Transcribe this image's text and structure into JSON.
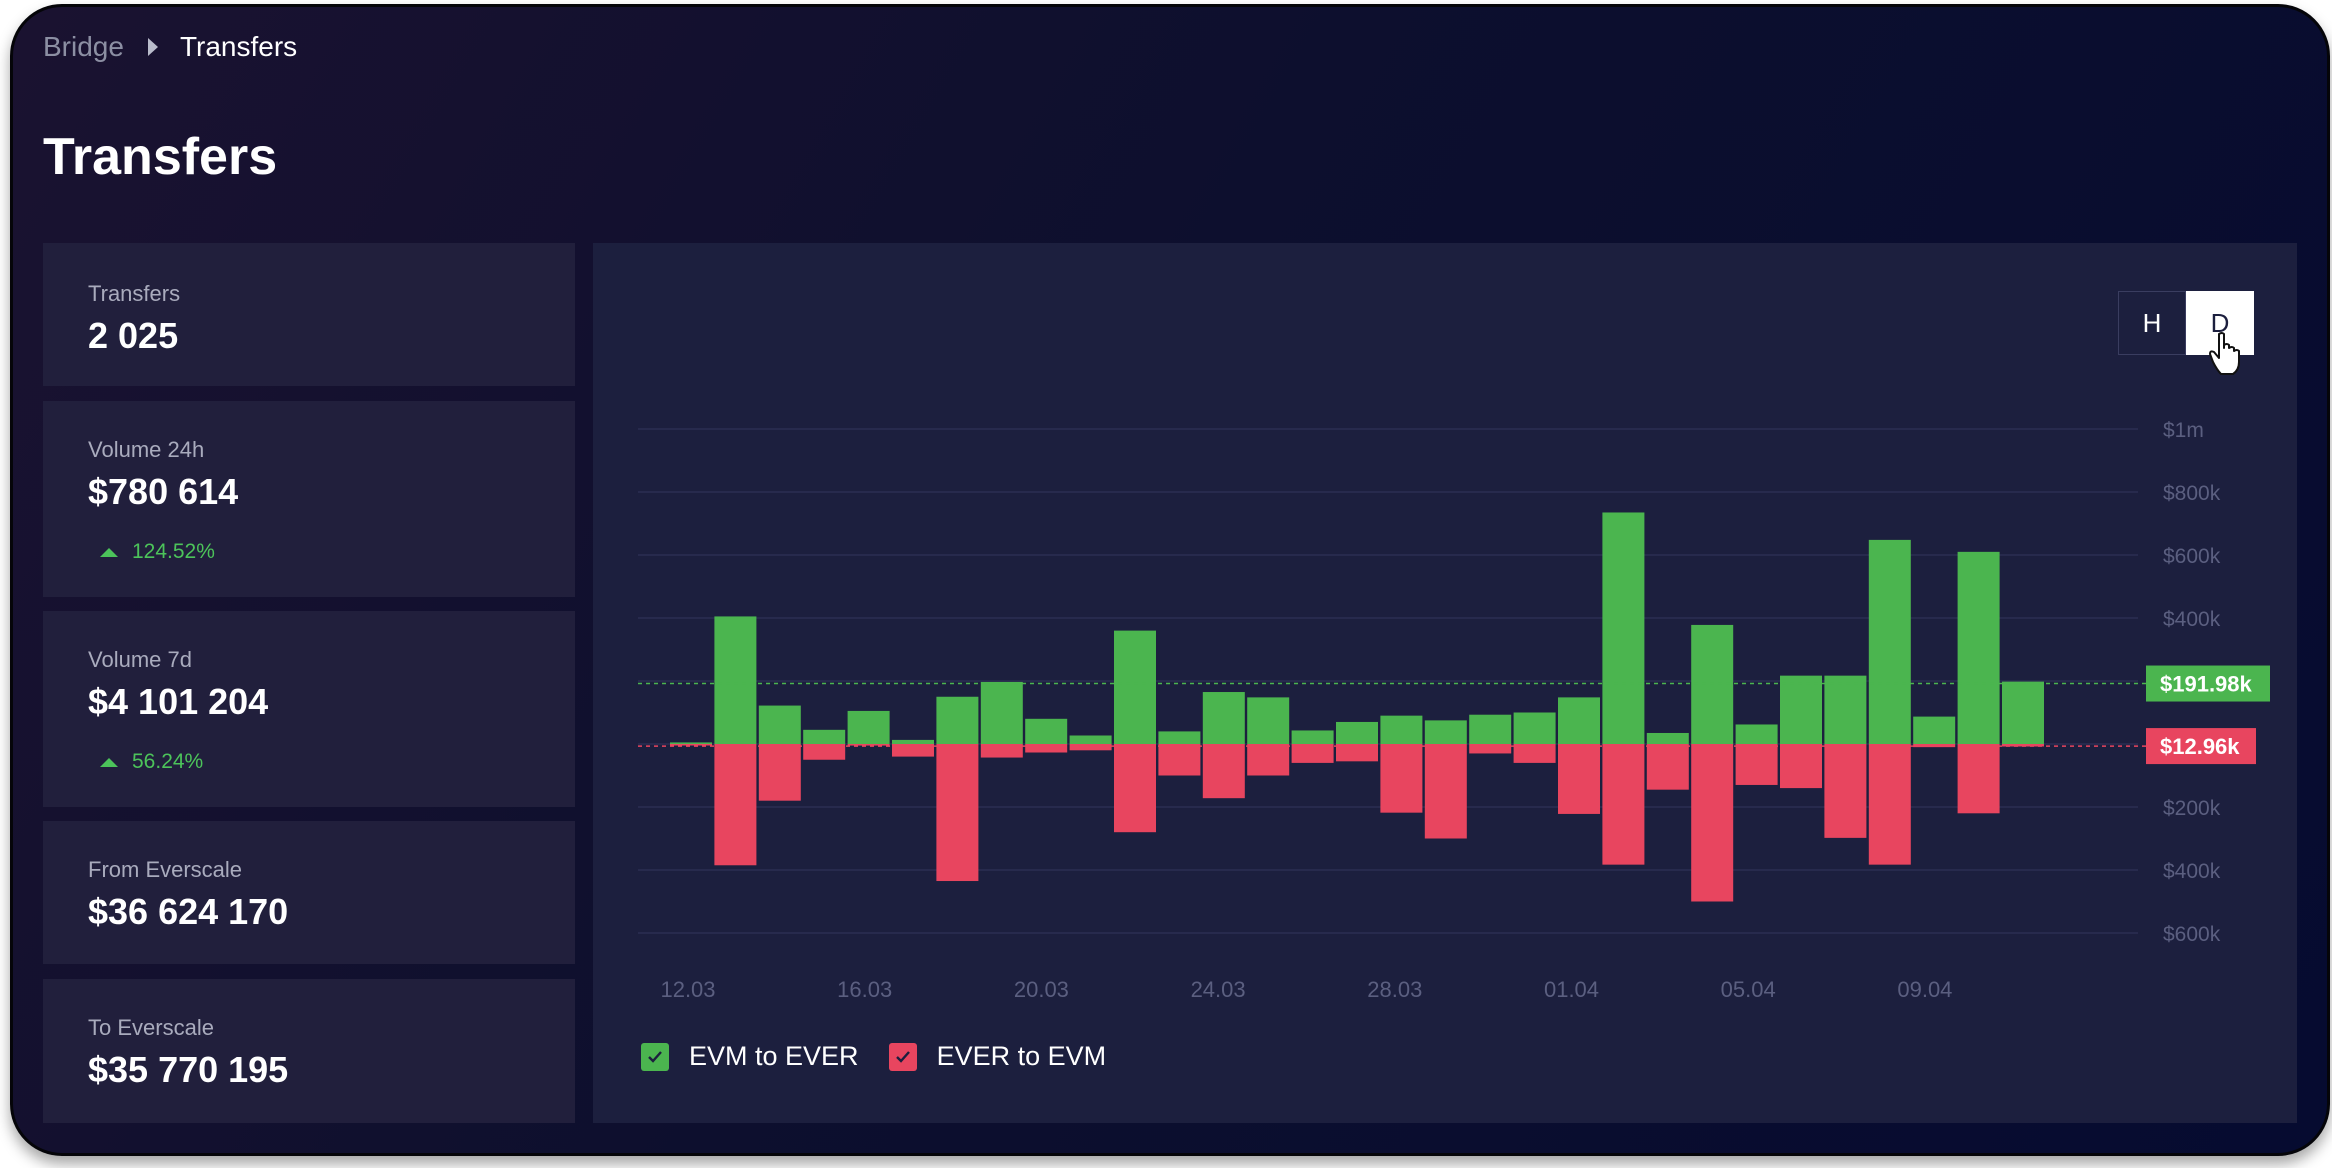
{
  "breadcrumb": {
    "parent": "Bridge",
    "current": "Transfers"
  },
  "page": {
    "title": "Transfers"
  },
  "stats": {
    "transfers": {
      "label": "Transfers",
      "value": "2 025"
    },
    "volume24h": {
      "label": "Volume 24h",
      "value": "$780 614",
      "delta": "124.52%"
    },
    "volume7d": {
      "label": "Volume 7d",
      "value": "$4 101 204",
      "delta": "56.24%"
    },
    "from_everscale": {
      "label": "From Everscale",
      "value": "$36 624 170"
    },
    "to_everscale": {
      "label": "To Everscale",
      "value": "$35 770 195"
    }
  },
  "toggle": {
    "h": "H",
    "d": "D",
    "active": "D"
  },
  "legend": {
    "evm_to_ever": "EVM to EVER",
    "ever_to_evm": "EVER to EVM"
  },
  "colors": {
    "green": "#4bb54f",
    "red": "#e8455f",
    "delta_green": "#4cc35a"
  },
  "chart_data": {
    "type": "bar",
    "y_ticks": [
      "$1m",
      "$800k",
      "$600k",
      "$400k",
      "$200k",
      "$200k",
      "$400k",
      "$600k"
    ],
    "x_ticks": [
      "12.03",
      "16.03",
      "20.03",
      "24.03",
      "28.03",
      "01.04",
      "05.04",
      "09.04"
    ],
    "ylim": [
      -600000,
      1000000
    ],
    "marker_values": {
      "evm_to_ever": 191980,
      "ever_to_evm": 12960
    },
    "marker_labels": {
      "evm_to_ever": "$191.98k",
      "ever_to_evm": "$12.96k"
    },
    "series": [
      {
        "name": "EVM to EVER",
        "values": [
          5000,
          405000,
          122000,
          45000,
          105000,
          13000,
          150000,
          197000,
          80000,
          27000,
          360000,
          40000,
          165000,
          148000,
          43000,
          70000,
          90000,
          75000,
          93000,
          100000,
          148000,
          735000,
          35000,
          378000,
          62000,
          217000,
          217000,
          648000,
          87000,
          610000,
          198000
        ]
      },
      {
        "name": "EVER to EVM",
        "values": [
          -3000,
          -385000,
          -180000,
          -50000,
          -5000,
          -40000,
          -435000,
          -43000,
          -27000,
          -20000,
          -280000,
          -100000,
          -172000,
          -100000,
          -60000,
          -55000,
          -218000,
          -300000,
          -30000,
          -60000,
          -222000,
          -383000,
          -145000,
          -500000,
          -130000,
          -140000,
          -298000,
          -383000,
          -10000,
          -220000,
          -8000
        ]
      }
    ]
  }
}
